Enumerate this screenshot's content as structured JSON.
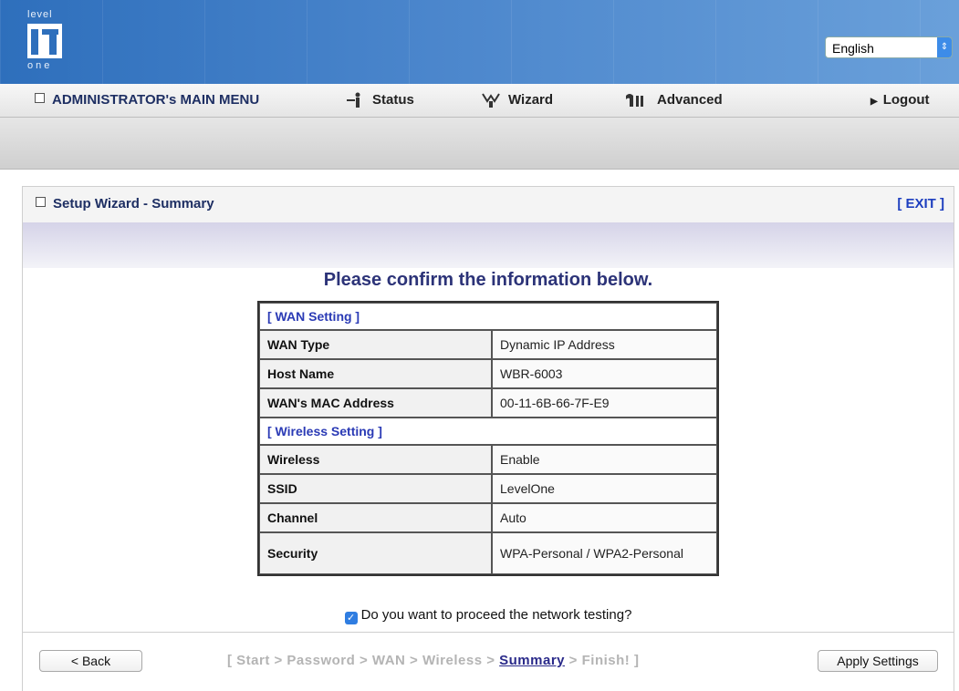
{
  "header": {
    "logo_top": "level",
    "logo_bottom": "one",
    "language": "English"
  },
  "menu": {
    "main_label": "ADMINISTRATOR's MAIN MENU",
    "status": "Status",
    "wizard": "Wizard",
    "advanced": "Advanced",
    "logout": "Logout"
  },
  "panel": {
    "title": "Setup Wizard - Summary",
    "exit": "[ EXIT ]",
    "heading": "Please confirm the information below."
  },
  "summary": {
    "wan_section": "[ WAN Setting ]",
    "wan_rows": [
      {
        "label": "WAN Type",
        "value": "Dynamic IP Address"
      },
      {
        "label": "Host Name",
        "value": "WBR-6003"
      },
      {
        "label": "WAN's MAC Address",
        "value": "00-11-6B-66-7F-E9"
      }
    ],
    "wireless_section": "[ Wireless Setting ]",
    "wireless_rows": [
      {
        "label": "Wireless",
        "value": "Enable"
      },
      {
        "label": "SSID",
        "value": "LevelOne"
      },
      {
        "label": "Channel",
        "value": "Auto"
      },
      {
        "label": "Security",
        "value": "WPA-Personal / WPA2-Personal"
      }
    ]
  },
  "proceed": {
    "checked": true,
    "text": "Do you want to proceed the network testing?"
  },
  "footer": {
    "back": "< Back",
    "apply": "Apply Settings",
    "steps_open": "[ Start > Password > WAN > Wireless > ",
    "steps_current": "Summary",
    "steps_close": " > Finish! ]"
  },
  "colors": {
    "header_blue": "#2e6fbc",
    "menu_text": "#1e2f63",
    "section_text": "#2a3ab5",
    "checkbox": "#2f7de1"
  }
}
